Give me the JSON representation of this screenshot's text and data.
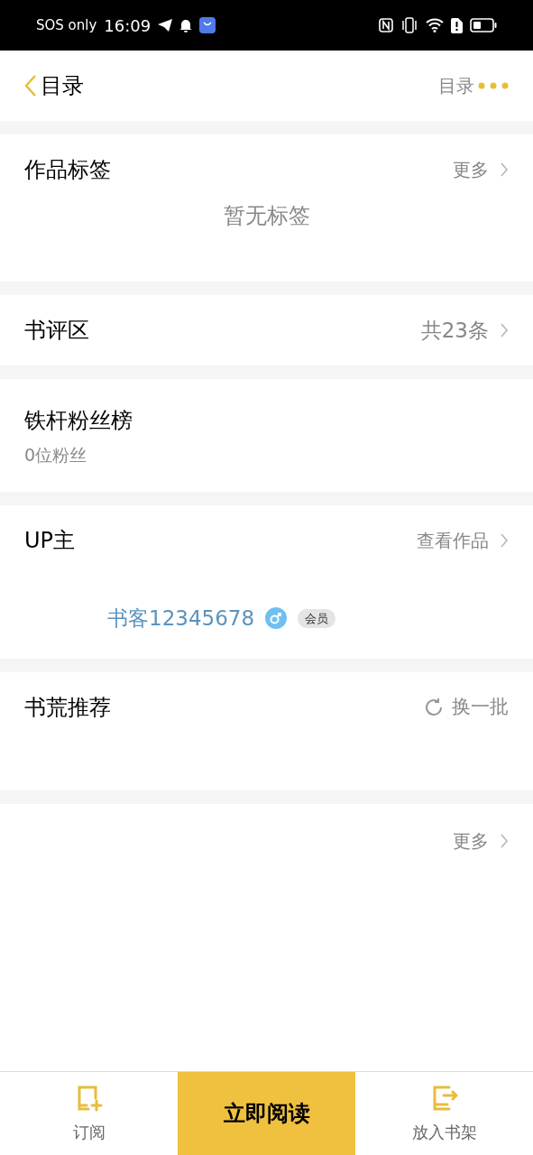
{
  "status_bar": {
    "carrier": "SOS only",
    "time": "16:09"
  },
  "header": {
    "title": "目录",
    "link": "目录"
  },
  "tags": {
    "title": "作品标签",
    "more": "更多",
    "empty": "暂无标签"
  },
  "reviews": {
    "title": "书评区",
    "count": "共23条"
  },
  "fans": {
    "title": "铁杆粉丝榜",
    "count": "0位粉丝"
  },
  "uploader": {
    "title": "UP主",
    "link": "查看作品",
    "name": "书客12345678",
    "male": true,
    "badge": "会员"
  },
  "recommend": {
    "title": "书荒推荐",
    "refresh": "换一批"
  },
  "more": {
    "link": "更多"
  },
  "bottom_bar": [
    {
      "kind": "subscribe",
      "label": "订阅"
    },
    {
      "kind": "primary",
      "label": "立即阅读"
    },
    {
      "kind": "shelf",
      "label": "放入书架"
    }
  ]
}
